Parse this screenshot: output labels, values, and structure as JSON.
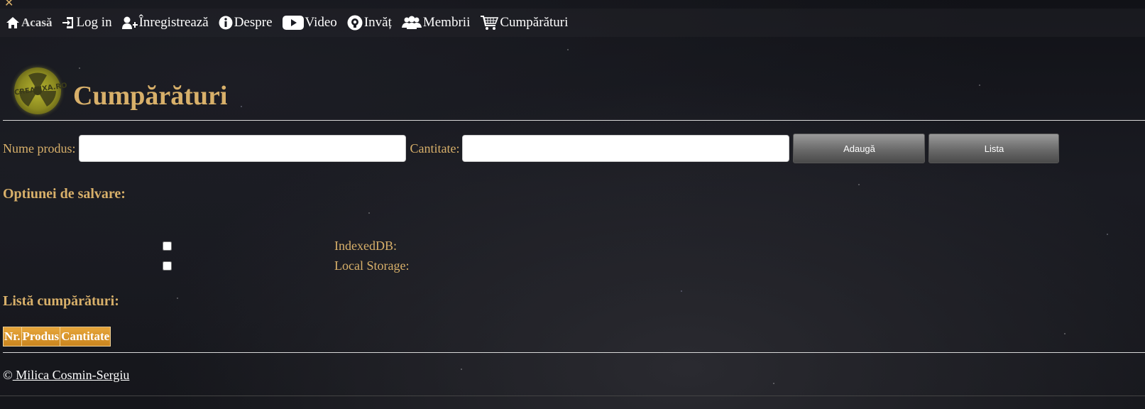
{
  "nav": {
    "items": [
      {
        "label": "Acasă",
        "icon": "home-icon"
      },
      {
        "label": "Log in",
        "icon": "login-icon"
      },
      {
        "label": "Înregistrează",
        "icon": "add-user-icon"
      },
      {
        "label": "Despre",
        "icon": "info-icon"
      },
      {
        "label": "Video",
        "icon": "youtube-icon"
      },
      {
        "label": "Invăț",
        "icon": "learn-icon"
      },
      {
        "label": "Membrii",
        "icon": "users-icon"
      },
      {
        "label": "Cumpărături",
        "icon": "cart-icon"
      }
    ]
  },
  "logo": {
    "text": "CREATIXA.RO"
  },
  "page": {
    "title": "Cumpărături"
  },
  "form": {
    "product_label": "Nume produs:",
    "product_value": "",
    "quantity_label": "Cantitate:",
    "quantity_value": "",
    "add_button": "Adaugă",
    "list_button": "Lista"
  },
  "options": {
    "heading": "Optiunei de salvare:",
    "items": [
      {
        "label": "IndexedDB:",
        "checked": false
      },
      {
        "label": "Local Storage:",
        "checked": false
      }
    ]
  },
  "list": {
    "heading": "Listă cumpărături:",
    "columns": [
      "Nr.",
      "Produs",
      "Cantitate"
    ]
  },
  "footer": {
    "copyright": "©",
    "author": " Milica Cosmin-Sergiu"
  },
  "colors": {
    "accent": "#d8b06a",
    "header_cell": "#d9962c",
    "text_light": "#ffffff"
  }
}
